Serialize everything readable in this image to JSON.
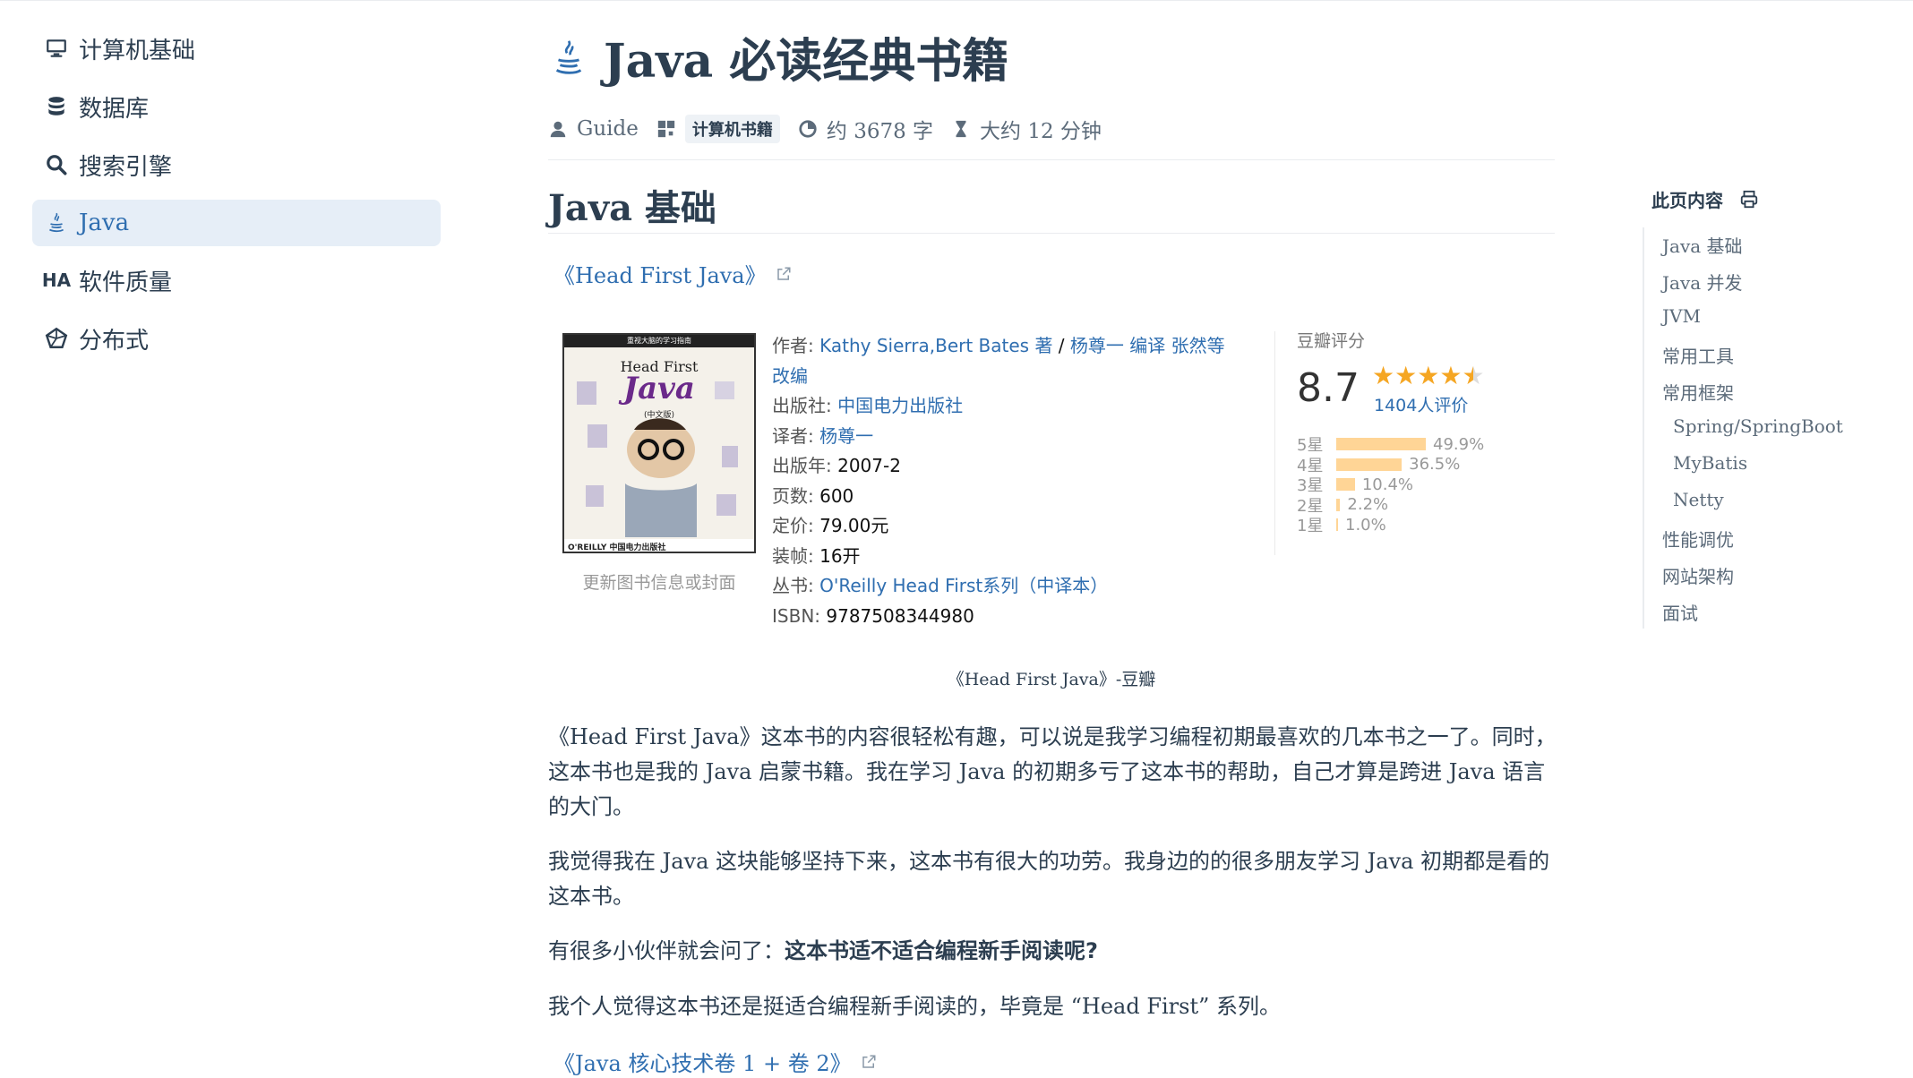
{
  "sidebar": {
    "items": [
      {
        "label": "计算机基础",
        "icon": "computer-icon"
      },
      {
        "label": "数据库",
        "icon": "database-icon"
      },
      {
        "label": "搜索引擎",
        "icon": "search-icon"
      },
      {
        "label": "Java",
        "icon": "java-icon",
        "active": true
      },
      {
        "label": "软件质量",
        "icon": "ha-icon",
        "prefix": "HA"
      },
      {
        "label": "分布式",
        "icon": "distributed-icon"
      }
    ]
  },
  "header": {
    "title": "Java 必读经典书籍",
    "author": "Guide",
    "category": "计算机书籍",
    "word_count": "约 3678 字",
    "read_time": "大约 12 分钟"
  },
  "section": {
    "heading": "Java 基础",
    "book_link": "《Head First Java》"
  },
  "book": {
    "cover_texts": {
      "top": "重视大脑的学习指南",
      "title1": "Head First",
      "title2": "Java",
      "subtitle": "(中文版)",
      "publisher": "O'REILLY 中国电力出版社"
    },
    "cover_caption": "更新图书信息或封面",
    "author_label": "作者:",
    "author_value_1": "Kathy Sierra,Bert Bates 著",
    "author_sep": " / ",
    "author_value_2": "杨尊一 编译 张然等 改编",
    "publisher_label": "出版社:",
    "publisher_value": "中国电力出版社",
    "translator_label": "译者:",
    "translator_value": "杨尊一",
    "year_label": "出版年:",
    "year_value": "2007-2",
    "pages_label": "页数:",
    "pages_value": "600",
    "price_label": "定价:",
    "price_value": "79.00元",
    "binding_label": "装帧:",
    "binding_value": "16开",
    "series_label": "丛书:",
    "series_value": "O'Reilly Head First系列（中译本）",
    "isbn_label": "ISBN:",
    "isbn_value": "9787508344980"
  },
  "douban": {
    "label": "豆瓣评分",
    "score": "8.7",
    "stars": 4.5,
    "count": "1404人评价",
    "distribution": [
      {
        "star": "5星",
        "pct": "49.9%",
        "value": 49.9
      },
      {
        "star": "4星",
        "pct": "36.5%",
        "value": 36.5
      },
      {
        "star": "3星",
        "pct": "10.4%",
        "value": 10.4
      },
      {
        "star": "2星",
        "pct": "2.2%",
        "value": 2.2
      },
      {
        "star": "1星",
        "pct": "1.0%",
        "value": 1.0
      }
    ]
  },
  "figure_caption": "《Head First Java》-豆瓣",
  "paragraphs": {
    "p1": "《Head First Java》这本书的内容很轻松有趣，可以说是我学习编程初期最喜欢的几本书之一了。同时，这本书也是我的 Java 启蒙书籍。我在学习 Java 的初期多亏了这本书的帮助，自己才算是跨进 Java 语言的大门。",
    "p2": "我觉得我在 Java 这块能够坚持下来，这本书有很大的功劳。我身边的的很多朋友学习 Java 初期都是看的这本书。",
    "p3_prefix": "有很多小伙伴就会问了：",
    "p3_bold": "这本书适不适合编程新手阅读呢?",
    "p4": "我个人觉得这本书还是挺适合编程新手阅读的，毕竟是 “Head First” 系列。",
    "next_link": "《Java 核心技术卷 1 + 卷 2》"
  },
  "toc": {
    "title": "此页内容",
    "items": [
      {
        "label": "Java 基础",
        "level": 1
      },
      {
        "label": "Java 并发",
        "level": 1
      },
      {
        "label": "JVM",
        "level": 1
      },
      {
        "label": "常用工具",
        "level": 1
      },
      {
        "label": "常用框架",
        "level": 1
      },
      {
        "label": "Spring/SpringBoot",
        "level": 2
      },
      {
        "label": "MyBatis",
        "level": 2
      },
      {
        "label": "Netty",
        "level": 2
      },
      {
        "label": "性能调优",
        "level": 1
      },
      {
        "label": "网站架构",
        "level": 1
      },
      {
        "label": "面试",
        "level": 1
      }
    ]
  },
  "colors": {
    "link": "#2f6eb0",
    "active_bg": "#e6eef7",
    "text": "#2c3e50",
    "bar": "#ffd596",
    "star": "#f5a623"
  }
}
